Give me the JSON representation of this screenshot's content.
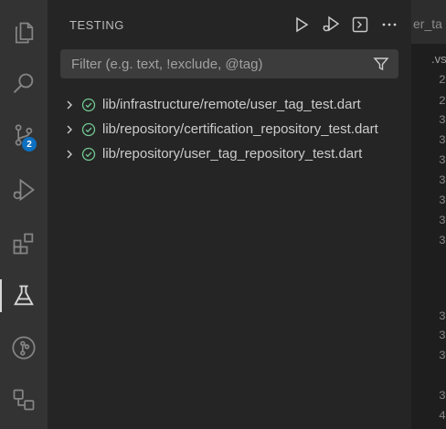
{
  "activity_bar": {
    "items": [
      {
        "icon": "files-icon"
      },
      {
        "icon": "search-icon"
      },
      {
        "icon": "source-control-icon",
        "badge": "2"
      },
      {
        "icon": "run-debug-icon"
      },
      {
        "icon": "extensions-icon"
      },
      {
        "icon": "testing-flask-icon",
        "active": true
      },
      {
        "icon": "git-graph-icon"
      },
      {
        "icon": "remote-explorer-icon"
      }
    ],
    "scm_badge": "2"
  },
  "sidebar": {
    "title": "TESTING",
    "actions": [
      "run-tests-icon",
      "debug-tests-icon",
      "show-output-icon",
      "more-actions-icon"
    ],
    "filter": {
      "placeholder": "Filter (e.g. text, !exclude, @tag)",
      "value": ""
    },
    "tests": [
      {
        "label": "lib/infrastructure/remote/user_tag_test.dart",
        "status": "passed"
      },
      {
        "label": "lib/repository/certification_repository_test.dart",
        "status": "passed"
      },
      {
        "label": "lib/repository/user_tag_repository_test.dart",
        "status": "passed"
      }
    ]
  },
  "editor": {
    "tab_partial": "er_ta",
    "breadcrumb_partial": ".vs",
    "line_numbers": [
      "2",
      "2",
      "3",
      "3",
      "3",
      "3",
      "3",
      "3",
      "3",
      "3",
      "3",
      "3",
      "3",
      "4"
    ]
  },
  "colors": {
    "activity_bar": "#333333",
    "sidebar": "#252526",
    "input": "#3c3c3c",
    "pass_green": "#73c991",
    "badge": "#0e70c0"
  }
}
